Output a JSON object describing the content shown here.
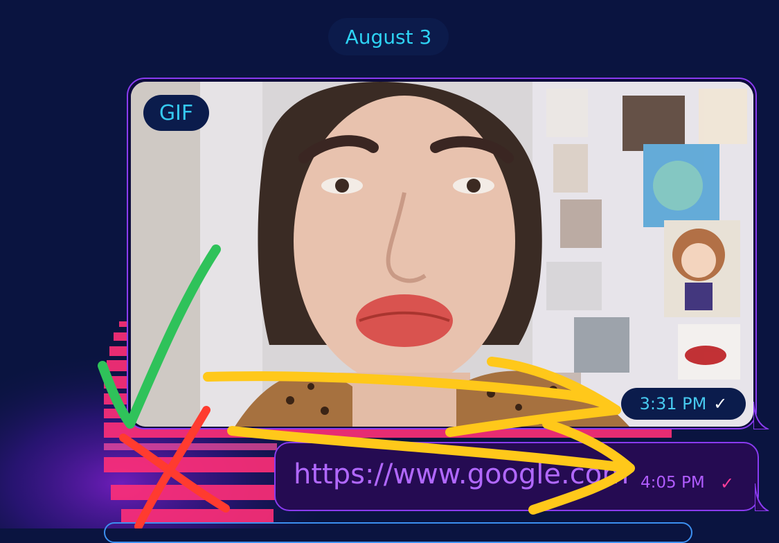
{
  "chat": {
    "date_label": "August 3",
    "gif_message": {
      "badge": "GIF",
      "time": "3:31 PM",
      "status_icon": "single-check-icon"
    },
    "link_message": {
      "text": "https://www.google.com",
      "time": "4:05 PM",
      "status_icon": "check-icon"
    }
  },
  "colors": {
    "background": "#0a1440",
    "accent_cyan": "#2ed3f4",
    "bubble_border": "#8a3bf0",
    "link_text": "#b168ff",
    "check_pink": "#ff3d9a",
    "annotation_green": "#2fc25a",
    "annotation_yellow": "#ffc81a",
    "annotation_red": "#ff3b2f"
  }
}
